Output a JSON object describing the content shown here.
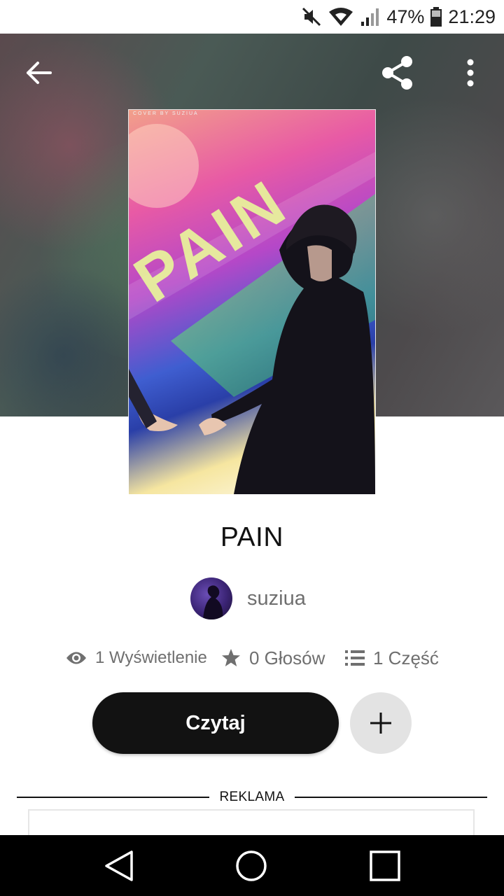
{
  "status_bar": {
    "battery_percent": "47%",
    "time": "21:29",
    "icons": [
      "mute-icon",
      "wifi-icon",
      "signal-icon",
      "battery-icon"
    ]
  },
  "header": {
    "icons": [
      "back-arrow-icon",
      "share-icon",
      "more-vert-icon"
    ]
  },
  "story": {
    "title": "PAIN",
    "cover_text": "PAIN",
    "cover_credit": "COVER BY SUZIUA",
    "author": "suziua"
  },
  "stats": {
    "reads_label": "1 Wyświetlenie",
    "votes_label": "0 Głosów",
    "parts_label": "1 Część"
  },
  "actions": {
    "read_label": "Czytaj",
    "add_icon": "plus-icon"
  },
  "ad": {
    "label": "REKLAMA"
  },
  "nav": {
    "icons": [
      "nav-back-icon",
      "nav-home-icon",
      "nav-recents-icon"
    ]
  },
  "colors": {
    "primary_button": "#121212",
    "secondary_text": "#6f6f6f",
    "add_button_bg": "#e3e3e3"
  }
}
